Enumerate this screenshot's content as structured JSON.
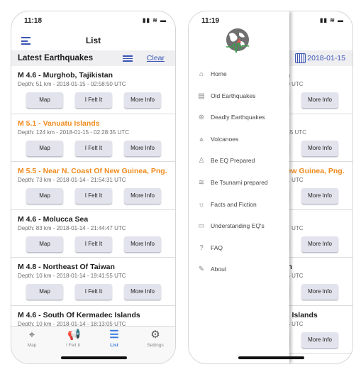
{
  "left": {
    "status_time": "11:18",
    "nav_title": "List",
    "section_title": "Latest Earthquakes",
    "clear_label": "Clear",
    "tabs": [
      {
        "label": "Map",
        "icon": "map-pin-icon"
      },
      {
        "label": "I Felt It",
        "icon": "megaphone-icon"
      },
      {
        "label": "List",
        "icon": "list-icon",
        "active": true
      },
      {
        "label": "Settings",
        "icon": "gear-icon"
      }
    ]
  },
  "right": {
    "status_time": "11:19",
    "date_label": "2018-01-15",
    "menu": [
      {
        "label": "Home",
        "icon": "home-icon"
      },
      {
        "label": "Old Earthquakes",
        "icon": "old-earthquakes-icon"
      },
      {
        "label": "Deadly Earthquakes",
        "icon": "deadly-icon"
      },
      {
        "label": "Volcanoes",
        "icon": "volcano-icon"
      },
      {
        "label": "Be EQ Prepared",
        "icon": "prepared-icon"
      },
      {
        "label": "Be Tsunami prepared",
        "icon": "tsunami-icon"
      },
      {
        "label": "Facts and Fiction",
        "icon": "bulb-icon"
      },
      {
        "label": "Understanding EQ's",
        "icon": "book-icon"
      },
      {
        "label": "FAQ",
        "icon": "question-icon"
      },
      {
        "label": "About",
        "icon": "about-icon"
      }
    ]
  },
  "buttons": {
    "map": "Map",
    "felt": "I Felt It",
    "info": "More Info"
  },
  "highlight_color": "#f08a1c",
  "accent_color": "#3a55b4",
  "earthquakes": [
    {
      "title": "M 4.6 -  Murghob, Tajikistan",
      "depth": "Depth: 51 km - 2018-01-15 - 02:58:50 UTC",
      "highlight": false
    },
    {
      "title": "M 5.1 - Vanuatu Islands",
      "depth": "Depth: 124 km - 2018-01-15 - 02:28:35 UTC",
      "highlight": true
    },
    {
      "title": "M 5.5 - Near N. Coast Of New Guinea, Png.",
      "depth": "Depth: 73 km - 2018-01-14 - 21:54:31 UTC",
      "highlight": true
    },
    {
      "title": "M 4.6 - Molucca Sea",
      "depth": "Depth: 83 km - 2018-01-14 - 21:44:47 UTC",
      "highlight": false
    },
    {
      "title": "M 4.8 - Northeast Of Taiwan",
      "depth": "Depth: 10 km - 2018-01-14 - 19:41:55 UTC",
      "highlight": false
    },
    {
      "title": "M 4.6 - South Of Kermadec Islands",
      "depth": "Depth: 10 km - 2018-01-14 - 18:13:05 UTC",
      "highlight": false
    }
  ]
}
